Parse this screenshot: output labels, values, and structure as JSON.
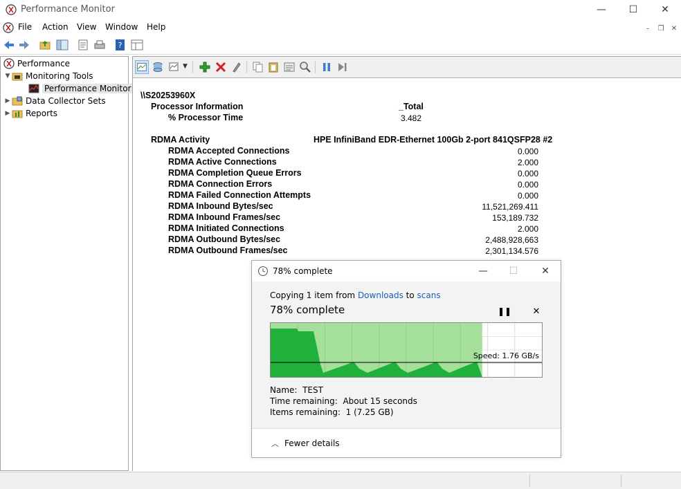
{
  "window": {
    "title": "Performance Monitor",
    "minimize": "—",
    "maximize": "☐",
    "close": "✕"
  },
  "menu": [
    "File",
    "Action",
    "View",
    "Window",
    "Help"
  ],
  "tree": {
    "root": "Performance",
    "monitoring_tools": "Monitoring Tools",
    "performance_monitor": "Performance Monitor",
    "data_collector_sets": "Data Collector Sets",
    "reports": "Reports"
  },
  "report": {
    "computer": "\\\\S20253960X",
    "sections": [
      {
        "object": "Processor Information",
        "instance": "_Total",
        "counters": [
          {
            "name": "% Processor Time",
            "value": "3.482"
          }
        ]
      },
      {
        "object": "RDMA Activity",
        "instance": "HPE InfiniBand EDR-Ethernet 100Gb 2-port 841QSFP28 #2",
        "counters": [
          {
            "name": "RDMA Accepted Connections",
            "value": "0.000"
          },
          {
            "name": "RDMA Active Connections",
            "value": "2.000"
          },
          {
            "name": "RDMA Completion Queue Errors",
            "value": "0.000"
          },
          {
            "name": "RDMA Connection Errors",
            "value": "0.000"
          },
          {
            "name": "RDMA Failed Connection Attempts",
            "value": "0.000"
          },
          {
            "name": "RDMA Inbound Bytes/sec",
            "value": "11,521,269.411"
          },
          {
            "name": "RDMA Inbound Frames/sec",
            "value": "153,189.732"
          },
          {
            "name": "RDMA Initiated Connections",
            "value": "2.000"
          },
          {
            "name": "RDMA Outbound Bytes/sec",
            "value": "2,488,928,663"
          },
          {
            "name": "RDMA Outbound Frames/sec",
            "value": "2,301,134.576"
          }
        ]
      }
    ]
  },
  "copy_dialog": {
    "title": "78% complete",
    "copying_prefix": "Copying 1 item from ",
    "source": "Downloads",
    "to_word": " to ",
    "destination": "scans",
    "heading": "78% complete",
    "progress": 0.78,
    "speed": "Speed: 1.76 GB/s",
    "name_label": "Name:",
    "name_value": "TEST",
    "time_label": "Time remaining:",
    "time_value": "About 15 seconds",
    "items_label": "Items remaining:",
    "items_value": "1 (7.25 GB)",
    "fewer_details": "Fewer details",
    "pause_icon": "pause-icon",
    "cancel_icon": "close-icon"
  },
  "colors": {
    "graph_fill_light": "#a5e09a",
    "graph_fill_dark": "#1fb13c",
    "link": "#1a5fb4"
  }
}
